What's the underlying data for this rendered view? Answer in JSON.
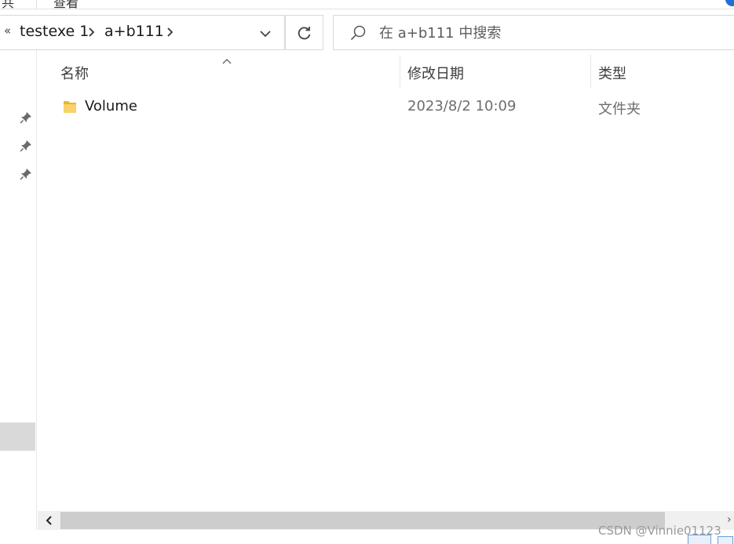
{
  "ribbon": {
    "fragment_left": "共",
    "fragment_mid": "查看"
  },
  "address": {
    "overflow_glyph": "«",
    "breadcrumbs": [
      "testexe 1",
      "a+b111"
    ]
  },
  "search": {
    "placeholder": "在 a+b111 中搜索"
  },
  "columns": {
    "name": "名称",
    "modified": "修改日期",
    "type": "类型"
  },
  "files": [
    {
      "name": "Volume",
      "modified": "2023/8/2 10:09",
      "type": "文件夹",
      "icon": "folder-icon"
    }
  ],
  "scrollbar": {
    "thumb_fraction": 0.87
  },
  "watermark": "CSDN @Vinnie01123",
  "colors": {
    "folder": "#f5c542",
    "accent": "#1f6fd6",
    "selection": "#d9d9d9"
  }
}
